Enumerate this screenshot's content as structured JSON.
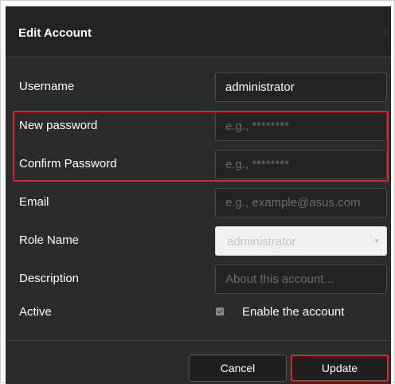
{
  "dialog": {
    "title": "Edit Account",
    "close_icon": "close-icon"
  },
  "form": {
    "username": {
      "label": "Username",
      "value": "administrator"
    },
    "new_password": {
      "label": "New password",
      "placeholder": "e.g., ********"
    },
    "confirm_password": {
      "label": "Confirm Password",
      "placeholder": "e.g., ********"
    },
    "email": {
      "label": "Email",
      "placeholder": "e.g., example@asus.com"
    },
    "role": {
      "label": "Role Name",
      "value": "administrator"
    },
    "description": {
      "label": "Description",
      "placeholder": "About this account..."
    },
    "active": {
      "label": "Active",
      "checkbox_label": "Enable the account",
      "checked": true
    }
  },
  "buttons": {
    "cancel": "Cancel",
    "update": "Update"
  },
  "colors": {
    "dialog_bg": "#2b2b2b",
    "header_bg": "#232323",
    "highlight": "#d6262e"
  }
}
